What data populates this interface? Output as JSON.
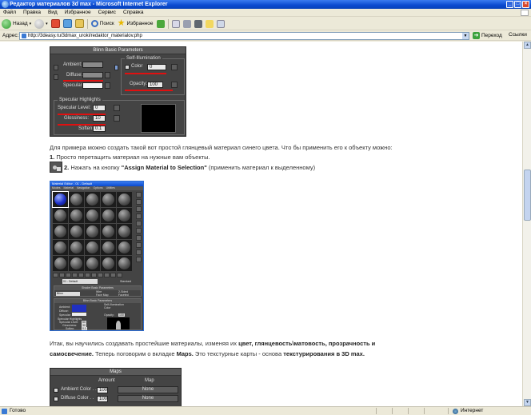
{
  "window": {
    "title": "Редактор материалов 3d max - Microsoft Internet Explorer",
    "controls": [
      "_",
      "□",
      "×"
    ]
  },
  "menu": [
    "Файл",
    "Правка",
    "Вид",
    "Избранное",
    "Сервис",
    "Справка"
  ],
  "toolbar": {
    "back": "Назад",
    "search": "Поиск",
    "favorites": "Избранное"
  },
  "address": {
    "label": "Адрес:",
    "url": "http://3deasy.ru/3dmax_uroki/redaktor_materialov.php",
    "go": "Переход",
    "links": "Ссылки"
  },
  "blinn_panel": {
    "title": "Blinn Basic Parameters",
    "ambient": "Ambient:",
    "diffuse": "Diffuse:",
    "specular": "Specular:",
    "self_illum_group": "Self-Illumination",
    "color": "Color",
    "color_value": "0",
    "opacity": "Opacity:",
    "opacity_value": "100",
    "highlights_group": "Specular Highlights",
    "specular_level": "Specular Level:",
    "specular_level_value": "0",
    "glossiness": "Glossiness:",
    "glossiness_value": "10",
    "soften": "Soften:",
    "soften_value": "0.1"
  },
  "article": {
    "p1": "Для примера можно создать такой вот простой глянцевый материал синего цвета. Что бы применить его к объекту можно:",
    "step1_num": "1.",
    "step1_text": " Просто перетащить материал на нужные вам объекты.",
    "step2_num": "2.",
    "step2_text": " Нажать на кнопку ",
    "step2_bold": "\"Assign Material to Selection\"",
    "step2_tail": " (применить материал к выделенному)",
    "p2_a": "Итак, вы научились создавать простейшие материалы, изменяя их ",
    "p2_b": "цвет, глянцевость\\матовость, прозрачность и",
    "p2_c": "самосвечение.",
    "p2_d": " Теперь поговорим о вкладке ",
    "p2_e": "Maps.",
    "p2_f": " Это текстурные карты - основа ",
    "p2_g": "текстурирования в 3D max."
  },
  "material_editor": {
    "title": "Material Editor - 01 - Default",
    "menu": [
      "Modes",
      "Material",
      "Navigation",
      "Options",
      "Utilities"
    ],
    "name": "01 - Default",
    "type": "Standard",
    "shader_section": "Shader Basic Parameters",
    "shader": "Blinn",
    "blinn_section": "Blinn Basic Parameters",
    "ambient": "Ambient:",
    "diffuse": "Diffuse:",
    "specular": "Specular:",
    "self_illum": "Self-Illumination",
    "color": "Color",
    "opacity": "Opacity:",
    "opacity_value": "100",
    "highlights": "Specular Highlights",
    "spec_level": "Specular Level:",
    "spec_level_value": "50",
    "gloss": "Glossiness:",
    "gloss_value": "30",
    "soften": "Soften:",
    "soften_value": "0.1",
    "options": [
      "Wire",
      "2-Sided",
      "Face Map",
      "Faceted"
    ]
  },
  "maps_panel": {
    "title": "Maps",
    "col_amount": "Amount",
    "col_map": "Map",
    "rows": [
      {
        "label": "Ambient Color . .",
        "amount": "100",
        "map": "None"
      },
      {
        "label": "Diffuse Color . .",
        "amount": "100",
        "map": "None"
      }
    ]
  },
  "status": {
    "left": "Готово",
    "zone": "Интернет"
  }
}
